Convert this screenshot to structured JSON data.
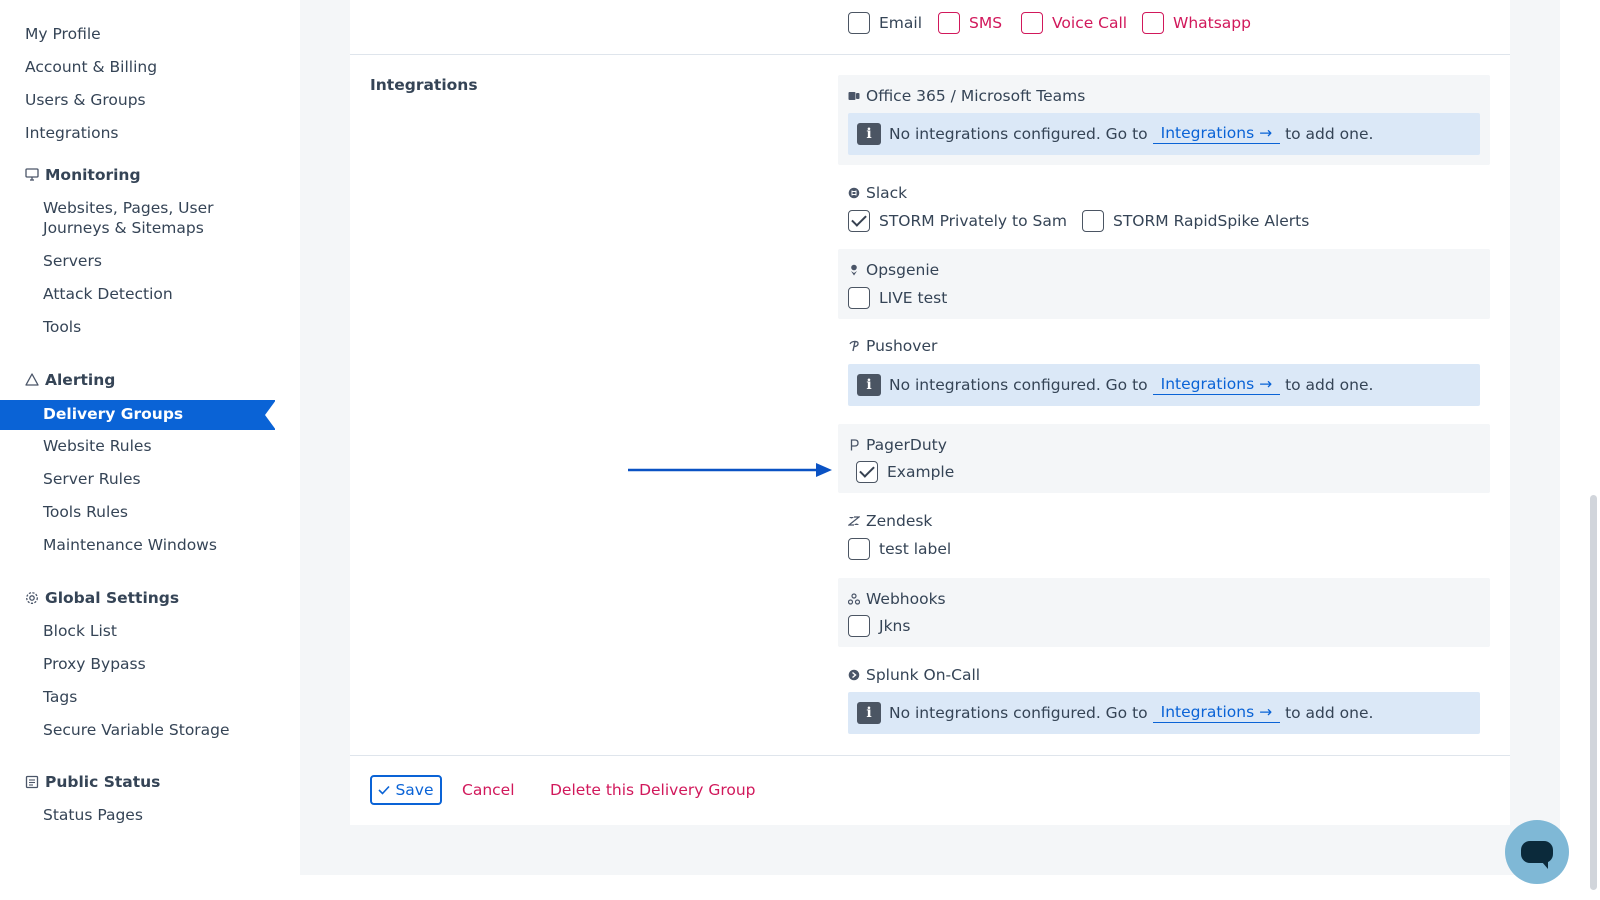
{
  "sidebar": {
    "top_items": [
      {
        "label": "My Profile"
      },
      {
        "label": "Account & Billing"
      },
      {
        "label": "Users & Groups"
      },
      {
        "label": "Integrations"
      }
    ],
    "monitoring": {
      "heading": "Monitoring",
      "icon": "monitor-icon",
      "items": [
        {
          "label": "Websites, Pages, User"
        },
        {
          "label": "Journeys & Sitemaps"
        },
        {
          "label": "Servers"
        },
        {
          "label": "Attack Detection"
        },
        {
          "label": "Tools"
        }
      ]
    },
    "alerting": {
      "heading": "Alerting",
      "icon": "warning-icon",
      "active_item": "Delivery Groups",
      "items": [
        {
          "label": "Website Rules"
        },
        {
          "label": "Server Rules"
        },
        {
          "label": "Tools Rules"
        },
        {
          "label": "Maintenance Windows"
        }
      ]
    },
    "global_settings": {
      "heading": "Global Settings",
      "icon": "gear-icon",
      "items": [
        {
          "label": "Block List"
        },
        {
          "label": "Proxy Bypass"
        },
        {
          "label": "Tags"
        },
        {
          "label": "Secure Variable Storage"
        }
      ]
    },
    "public_status": {
      "heading": "Public Status",
      "icon": "document-icon",
      "items": [
        {
          "label": "Status Pages"
        }
      ]
    }
  },
  "channels": {
    "email": {
      "label": "Email",
      "checked": false
    },
    "sms": {
      "label": "SMS",
      "checked": false
    },
    "voice": {
      "label": "Voice Call",
      "checked": false
    },
    "whatsapp": {
      "label": "Whatsapp",
      "checked": false
    }
  },
  "integrations": {
    "section_label": "Integrations",
    "alert_text_before": "No integrations configured. Go to",
    "alert_link": "Integrations →",
    "alert_text_after": "to add one.",
    "alert_icon": "i",
    "office365": {
      "title": "Office 365 / Microsoft Teams",
      "icon": "teams-icon"
    },
    "slack": {
      "title": "Slack",
      "icon": "slack-icon",
      "options": [
        {
          "label": "STORM Privately to Sam",
          "checked": true
        },
        {
          "label": "STORM RapidSpike Alerts",
          "checked": false
        }
      ]
    },
    "opsgenie": {
      "title": "Opsgenie",
      "icon": "opsgenie-icon",
      "options": [
        {
          "label": "LIVE test",
          "checked": false
        }
      ]
    },
    "pushover": {
      "title": "Pushover",
      "icon": "pushover-icon"
    },
    "pagerduty": {
      "title": "PagerDuty",
      "icon": "pagerduty-icon",
      "options": [
        {
          "label": "Example",
          "checked": true
        }
      ]
    },
    "zendesk": {
      "title": "Zendesk",
      "icon": "zendesk-icon",
      "options": [
        {
          "label": "test label",
          "checked": false
        }
      ]
    },
    "webhooks": {
      "title": "Webhooks",
      "icon": "webhooks-icon",
      "options": [
        {
          "label": "Jkns",
          "checked": false
        }
      ]
    },
    "splunk": {
      "title": "Splunk On-Call",
      "icon": "splunk-icon"
    }
  },
  "actions": {
    "save": "Save",
    "cancel": "Cancel",
    "delete": "Delete this Delivery Group"
  },
  "colors": {
    "accent": "#0a63d6",
    "danger": "#d1185b",
    "alert_bg": "#dbe8f7"
  }
}
